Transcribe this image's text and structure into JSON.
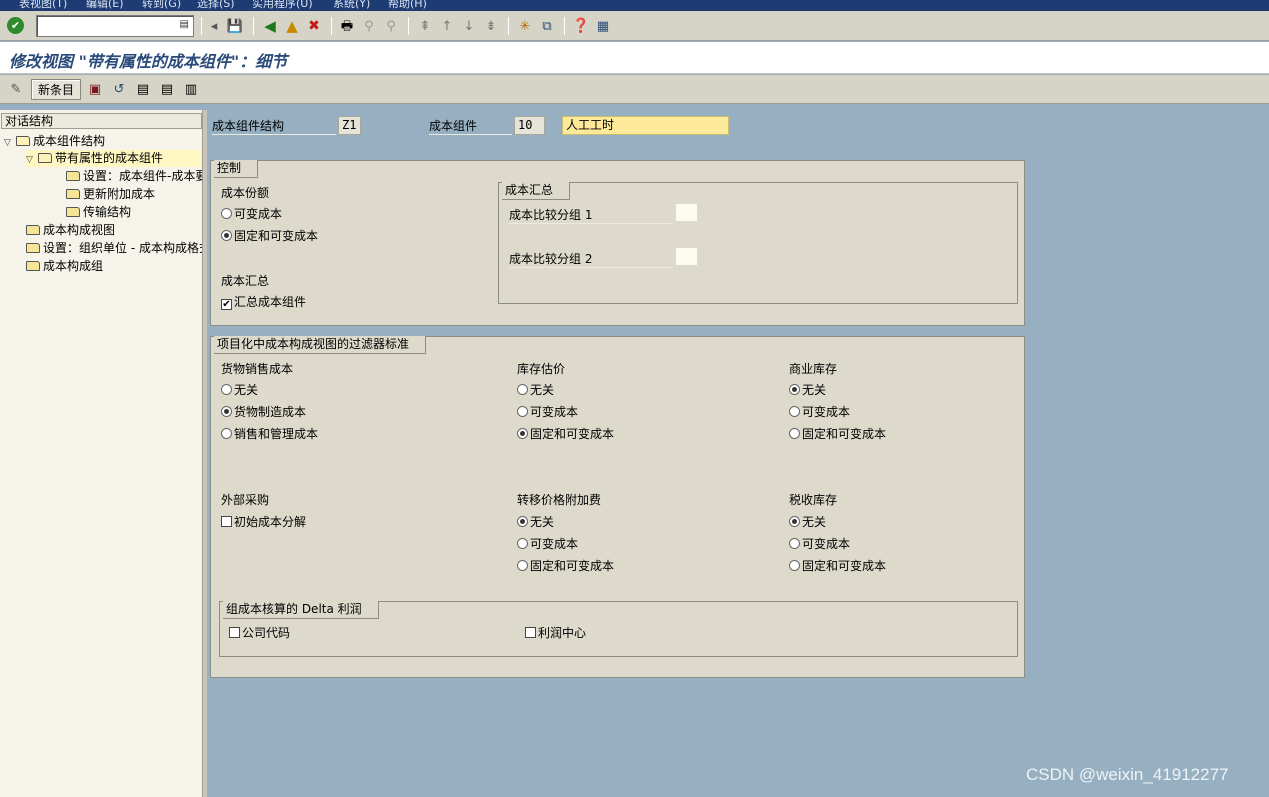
{
  "menu": [
    "表视图(T)",
    "编辑(E)",
    "转到(G)",
    "选择(S)",
    "实用程序(U)",
    "系统(Y)",
    "帮助(H)"
  ],
  "window_title": "修改视图 \"带有属性的成本组件\"：细节",
  "app_toolbar": {
    "new_entries_label": "新条目"
  },
  "left_pane": {
    "header": "对话结构",
    "items": [
      {
        "label": "成本组件结构"
      },
      {
        "label": "带有属性的成本组件"
      },
      {
        "label": "设置：成本组件-成本要素"
      },
      {
        "label": "更新附加成本"
      },
      {
        "label": "传输结构"
      },
      {
        "label": "成本构成视图"
      },
      {
        "label": "设置：组织单位 - 成本构成格式"
      },
      {
        "label": "成本构成组"
      }
    ]
  },
  "header_fields": {
    "structure_label": "成本组件结构",
    "structure_value": "Z1",
    "component_label": "成本组件",
    "component_value": "10",
    "component_text": "人工工时"
  },
  "control": {
    "title": "控制",
    "share_label": "成本份额",
    "share_options": [
      {
        "label": "可变成本",
        "selected": false
      },
      {
        "label": "固定和可变成本",
        "selected": true
      }
    ],
    "rollup_label": "成本汇总",
    "rollup_checkbox": {
      "label": "汇总成本组件",
      "checked": true
    },
    "rollup_box": {
      "title": "成本汇总",
      "group1_label": "成本比较分组 1",
      "group1_value": "",
      "group2_label": "成本比较分组 2",
      "group2_value": ""
    }
  },
  "filter": {
    "title": "项目化中成本构成视图的过滤器标准",
    "cogs": {
      "label": "货物销售成本",
      "options": [
        {
          "label": "无关",
          "selected": false
        },
        {
          "label": "货物制造成本",
          "selected": true
        },
        {
          "label": "销售和管理成本",
          "selected": false
        }
      ]
    },
    "inventory": {
      "label": "库存估价",
      "options": [
        {
          "label": "无关",
          "selected": false
        },
        {
          "label": "可变成本",
          "selected": false
        },
        {
          "label": "固定和可变成本",
          "selected": true
        }
      ]
    },
    "commercial": {
      "label": "商业库存",
      "options": [
        {
          "label": "无关",
          "selected": true
        },
        {
          "label": "可变成本",
          "selected": false
        },
        {
          "label": "固定和可变成本",
          "selected": false
        }
      ]
    },
    "external": {
      "label": "外部采购",
      "checkbox": {
        "label": "初始成本分解",
        "checked": false
      }
    },
    "transfer": {
      "label": "转移价格附加费",
      "options": [
        {
          "label": "无关",
          "selected": true
        },
        {
          "label": "可变成本",
          "selected": false
        },
        {
          "label": "固定和可变成本",
          "selected": false
        }
      ]
    },
    "tax": {
      "label": "税收库存",
      "options": [
        {
          "label": "无关",
          "selected": true
        },
        {
          "label": "可变成本",
          "selected": false
        },
        {
          "label": "固定和可变成本",
          "selected": false
        }
      ]
    },
    "delta": {
      "title": "组成本核算的 Delta 利润",
      "company_code": {
        "label": "公司代码",
        "checked": false
      },
      "profit_center": {
        "label": "利润中心",
        "checked": false
      }
    }
  },
  "watermark": "CSDN @weixin_41912277"
}
